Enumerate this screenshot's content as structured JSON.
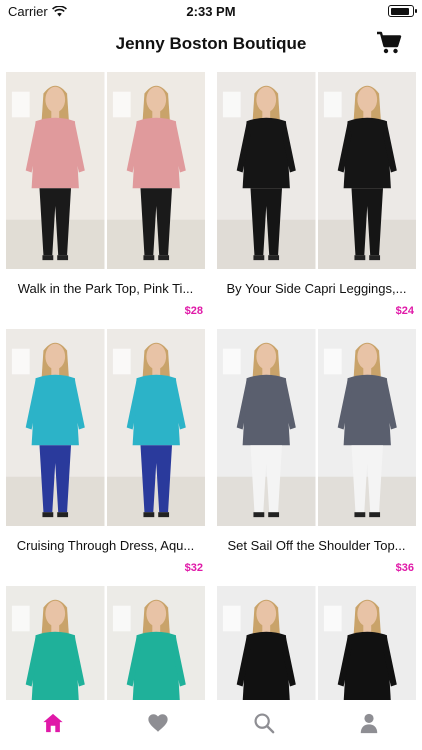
{
  "status_bar": {
    "carrier": "Carrier",
    "time": "2:33 PM",
    "battery_level": 0.9
  },
  "header": {
    "title": "Jenny Boston Boutique",
    "cart_icon": "shopping-cart-icon"
  },
  "products": [
    {
      "name": "Walk in the Park Top, Pink Ti...",
      "price": "$28",
      "garment_color": "#e09a9c",
      "bottom_color": "#1a1a1a",
      "bg_color": "#eeeae4"
    },
    {
      "name": "By Your Side Capri Leggings,...",
      "price": "$24",
      "garment_color": "#151515",
      "bottom_color": "#151515",
      "bg_color": "#ece9e6"
    },
    {
      "name": "Cruising Through Dress, Aqu...",
      "price": "$32",
      "garment_color": "#2cb3c8",
      "bottom_color": "#2a3a9c",
      "bg_color": "#edeae6"
    },
    {
      "name": "Set Sail Off the Shoulder Top...",
      "price": "$36",
      "garment_color": "#5a5f6e",
      "bottom_color": "#f4f4f4",
      "bg_color": "#eeeeee"
    },
    {
      "name": "",
      "price": "",
      "garment_color": "#1fb19a",
      "bottom_color": "#f4f4f4",
      "bg_color": "#ecebe7"
    },
    {
      "name": "",
      "price": "",
      "garment_color": "#111111",
      "bottom_color": "#e8157a",
      "bg_color": "#ededed"
    }
  ],
  "tab_bar": {
    "active_color": "#e019a8",
    "inactive_color": "#8e8e93",
    "tabs": [
      {
        "icon": "home-icon",
        "active": true
      },
      {
        "icon": "heart-icon",
        "active": false
      },
      {
        "icon": "search-icon",
        "active": false
      },
      {
        "icon": "profile-icon",
        "active": false
      }
    ]
  }
}
